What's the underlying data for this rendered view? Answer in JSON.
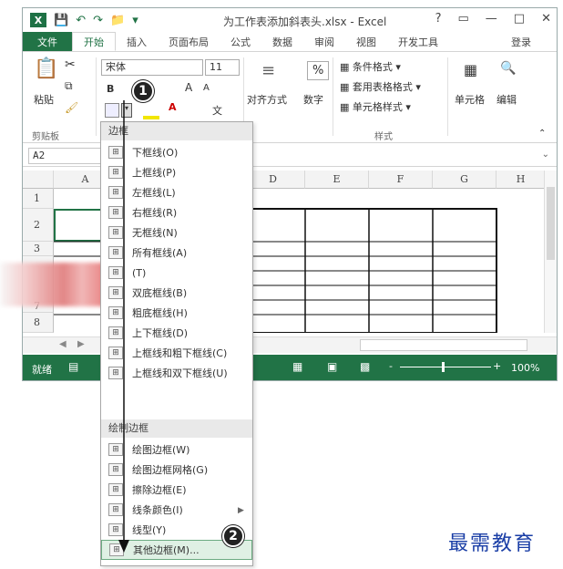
{
  "titlebar": {
    "logo": "X",
    "title": "为工作表添加斜表头.xlsx - Excel",
    "help": "?",
    "controls": [
      "▭",
      "—",
      "□",
      "✕"
    ]
  },
  "tabs": [
    "文件",
    "开始",
    "插入",
    "页面布局",
    "公式",
    "数据",
    "审阅",
    "视图",
    "开发工具"
  ],
  "login": "登录",
  "ribbon": {
    "paste": "粘贴",
    "clipboard_label": "剪贴板",
    "font_name": "宋体",
    "font_size": "11",
    "bold": "B",
    "grow": "A",
    "shrink": "A",
    "wen": "文",
    "align_label": "对齐方式",
    "number_label": "数字",
    "percent": "%",
    "cond_format": "条件格式",
    "table_format": "套用表格格式",
    "cell_style": "单元格样式",
    "styles_label": "样式",
    "cells_label": "单元格",
    "editing_label": "编辑"
  },
  "namebox": "A2",
  "columns": [
    "A",
    "D",
    "E",
    "F",
    "G",
    "H"
  ],
  "rows": [
    "1",
    "2",
    "3",
    "7",
    "8"
  ],
  "status": {
    "ready": "就绪",
    "zoom": "100%",
    "plus": "+",
    "minus": "-"
  },
  "menu": {
    "header1": "边框",
    "items1": [
      {
        "label": "下框线(O)",
        "icon": "bottom-border-icon"
      },
      {
        "label": "上框线(P)",
        "icon": "top-border-icon"
      },
      {
        "label": "左框线(L)",
        "icon": "left-border-icon"
      },
      {
        "label": "右框线(R)",
        "icon": "right-border-icon"
      },
      {
        "label": "无框线(N)",
        "icon": "no-border-icon"
      },
      {
        "label": "所有框线(A)",
        "icon": "all-borders-icon"
      },
      {
        "label": "(T)",
        "icon": "thick-box-border-icon"
      },
      {
        "label": "双底框线(B)",
        "icon": "double-bottom-border-icon"
      },
      {
        "label": "粗底框线(H)",
        "icon": "thick-bottom-border-icon"
      },
      {
        "label": "上下框线(D)",
        "icon": "top-bottom-border-icon"
      },
      {
        "label": "上框线和粗下框线(C)",
        "icon": "top-thick-bottom-border-icon"
      },
      {
        "label": "上框线和双下框线(U)",
        "icon": "top-double-bottom-border-icon"
      }
    ],
    "header2": "绘制边框",
    "items2": [
      {
        "label": "绘图边框(W)",
        "icon": "draw-border-icon"
      },
      {
        "label": "绘图边框网格(G)",
        "icon": "draw-border-grid-icon"
      },
      {
        "label": "擦除边框(E)",
        "icon": "eraser-icon"
      },
      {
        "label": "线条颜色(I)",
        "icon": "line-color-icon"
      },
      {
        "label": "线型(Y)",
        "icon": "line-style-icon"
      },
      {
        "label": "其他边框(M)...",
        "icon": "more-borders-icon"
      }
    ]
  },
  "callouts": [
    "1",
    "2"
  ],
  "watermark": "最需教育",
  "colors": {
    "excel_green": "#217346",
    "highlight": "#dff0e4"
  }
}
